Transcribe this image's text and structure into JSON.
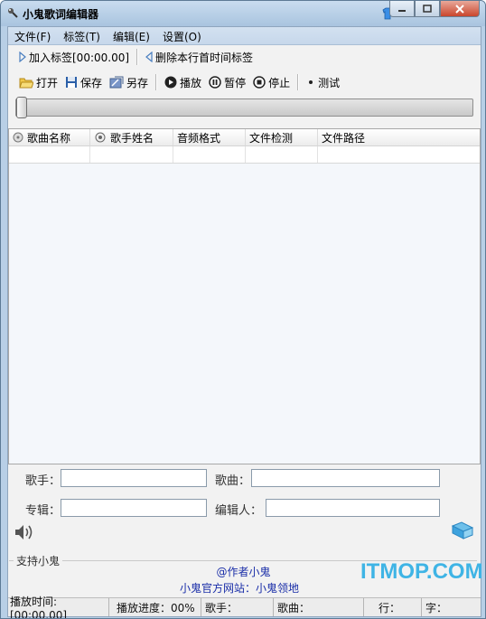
{
  "window": {
    "title": "小鬼歌词编辑器"
  },
  "menu": [
    "文件(F)",
    "标签(T)",
    "编辑(E)",
    "设置(O)"
  ],
  "toolbar1": {
    "add_tag": "加入标签[00:00.00]",
    "delete_tag": "删除本行首时间标签"
  },
  "toolbar2": {
    "open": "打开",
    "save": "保存",
    "save_as": "另存",
    "play": "播放",
    "pause": "暂停",
    "stop": "停止",
    "test": "测试"
  },
  "progress": {
    "value": 0
  },
  "table": {
    "columns": [
      "歌曲名称",
      "歌手姓名",
      "音频格式",
      "文件检测",
      "文件路径"
    ]
  },
  "form": {
    "singer_label": "歌手：",
    "singer_value": "",
    "song_label": "歌曲：",
    "song_value": "",
    "album_label": "专辑：",
    "album_value": "",
    "editor_label": "编辑人：",
    "editor_value": ""
  },
  "footer": {
    "group_label": "支持小鬼",
    "author": "@作者小鬼",
    "site_label": "小鬼官方网站：",
    "site_link": "小鬼领地"
  },
  "status": {
    "play_time": "播放时间:[00:00.00]",
    "play_progress": "播放进度：00%",
    "singer": "歌手：",
    "song": "歌曲：",
    "line": "行：",
    "char": "字："
  },
  "watermark": "ITMOP.COM",
  "colors": {
    "accent": "#3fb4e5",
    "link": "#1a2ea8"
  }
}
